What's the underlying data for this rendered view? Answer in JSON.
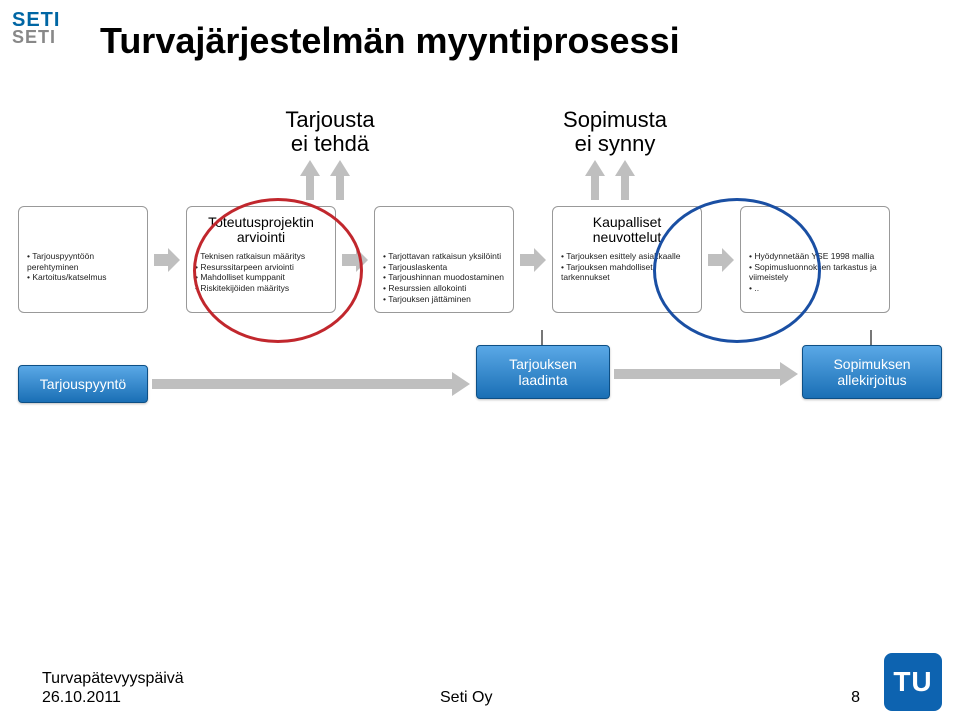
{
  "logo": {
    "line1": "SETI",
    "line2": "SETI"
  },
  "title": "Turvajärjestelmän myyntiprosessi",
  "branches": {
    "left": "Tarjousta\nei tehdä",
    "right": "Sopimusta\nei synny"
  },
  "columns": [
    {
      "header": "",
      "items": [
        "Tarjouspyyntöön perehtyminen",
        "Kartoitus/katselmus"
      ]
    },
    {
      "header": "Toteutusprojektin arviointi",
      "items": [
        "Teknisen ratkaisun määritys",
        "Resurssitarpeen arviointi",
        "Mahdolliset kumppanit",
        "Riskitekijöiden määritys"
      ]
    },
    {
      "header": "",
      "items": [
        "Tarjottavan ratkaisun yksilöinti",
        "Tarjouslaskenta",
        "Tarjoushinnan muodostaminen",
        "Resurssien allokointi",
        "Tarjouksen jättäminen"
      ]
    },
    {
      "header": "Kaupalliset neuvottelut",
      "items": [
        "Tarjouksen esittely asiakkaalle",
        "Tarjouksen mahdolliset tarkennukset"
      ]
    },
    {
      "header": "",
      "items": [
        "Hyödynnetään YSE 1998 mallia",
        "Sopimusluonnoksen tarkastus ja viimeistely",
        ".."
      ]
    }
  ],
  "steps": [
    "Tarjouspyyntö",
    "Tarjouksen laadinta",
    "Sopimuksen allekirjoitus"
  ],
  "footer": {
    "event": "Turvapätevyyspäivä",
    "date": "26.10.2011",
    "org": "Seti Oy",
    "page": "8",
    "badge": "TU"
  },
  "chart_data": {
    "type": "diagram",
    "title": "Turvajärjestelmän myyntiprosessi",
    "main_steps": [
      "Tarjouspyyntö",
      "Tarjouksen laadinta",
      "Sopimuksen allekirjoitus"
    ],
    "exit_branches": [
      {
        "after": "Toteutusprojektin arviointi",
        "label": "Tarjousta ei tehdä"
      },
      {
        "after": "Kaupalliset neuvottelut",
        "label": "Sopimusta ei synny"
      }
    ],
    "highlighted": [
      {
        "node": "Toteutusprojektin arviointi",
        "color": "red"
      },
      {
        "node": "Kaupalliset neuvottelut",
        "color": "blue"
      }
    ],
    "stage_details": {
      "Tarjouspyyntö (pre)": [
        "Tarjouspyyntöön perehtyminen",
        "Kartoitus/katselmus"
      ],
      "Toteutusprojektin arviointi": [
        "Teknisen ratkaisun määritys",
        "Resurssitarpeen arviointi",
        "Mahdolliset kumppanit",
        "Riskitekijöiden määritys"
      ],
      "Tarjouksen laadinta": [
        "Tarjottavan ratkaisun yksilöinti",
        "Tarjouslaskenta",
        "Tarjoushinnan muodostaminen",
        "Resurssien allokointi",
        "Tarjouksen jättäminen"
      ],
      "Kaupalliset neuvottelut": [
        "Tarjouksen esittely asiakkaalle",
        "Tarjouksen mahdolliset tarkennukset"
      ],
      "Sopimuksen allekirjoitus": [
        "Hyödynnetään YSE 1998 mallia",
        "Sopimusluonnoksen tarkastus ja viimeistely",
        ".."
      ]
    }
  }
}
